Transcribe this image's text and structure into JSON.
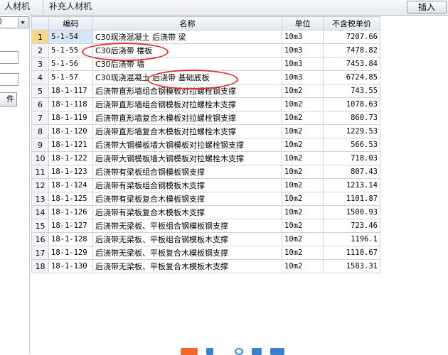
{
  "tabs": [
    "人材机",
    "补充人材机"
  ],
  "insert_button": "插入",
  "left_panel": {
    "combo_value": ")",
    "button_label": "件"
  },
  "columns": {
    "index": "",
    "code": "编码",
    "name": "名称",
    "unit": "单位",
    "price": "不含税单价"
  },
  "rows": [
    {
      "index": "1",
      "code": "5-1-54",
      "name": "C30现浇混凝土 后浇带 梁",
      "unit": "10m3",
      "price": "7207.66"
    },
    {
      "index": "2",
      "code": "5-1-55",
      "name": "C30后浇带 楼板",
      "unit": "10m3",
      "price": "7478.82"
    },
    {
      "index": "3",
      "code": "5-1-56",
      "name": "C30后浇带 墙",
      "unit": "10m3",
      "price": "7453.84"
    },
    {
      "index": "4",
      "code": "5-1-57",
      "name": "C30现浇混凝土 后浇带 基础底板",
      "unit": "10m3",
      "price": "6724.85"
    },
    {
      "index": "5",
      "code": "18-1-117",
      "name": "后浇带直形墙组合钢模板对拉螺栓钢支撑",
      "unit": "10m2",
      "price": "743.55"
    },
    {
      "index": "6",
      "code": "18-1-118",
      "name": "后浇带直形墙组合钢模板对拉螺栓木支撑",
      "unit": "10m2",
      "price": "1078.63"
    },
    {
      "index": "7",
      "code": "18-1-119",
      "name": "后浇带直形墙复合木模板对拉螺栓钢支撑",
      "unit": "10m2",
      "price": "860.73"
    },
    {
      "index": "8",
      "code": "18-1-120",
      "name": "后浇带直形墙复合木模板对拉螺栓木支撑",
      "unit": "10m2",
      "price": "1229.53"
    },
    {
      "index": "9",
      "code": "18-1-121",
      "name": "后浇带大钢模板墙大钢模板对拉螺栓钢支撑",
      "unit": "10m2",
      "price": "566.53"
    },
    {
      "index": "10",
      "code": "18-1-122",
      "name": "后浇带大钢模板墙大钢模板对拉螺栓木支撑",
      "unit": "10m2",
      "price": "718.03"
    },
    {
      "index": "11",
      "code": "18-1-123",
      "name": "后浇带有梁板组合钢模板钢支撑",
      "unit": "10m2",
      "price": "807.43"
    },
    {
      "index": "12",
      "code": "18-1-124",
      "name": "后浇带有梁板组合钢模板木支撑",
      "unit": "10m2",
      "price": "1213.14"
    },
    {
      "index": "13",
      "code": "18-1-125",
      "name": "后浇带有梁板复合木模板钢支撑",
      "unit": "10m2",
      "price": "1101.87"
    },
    {
      "index": "14",
      "code": "18-1-126",
      "name": "后浇带有梁板复合木模板木支撑",
      "unit": "10m2",
      "price": "1500.93"
    },
    {
      "index": "15",
      "code": "18-1-127",
      "name": "后浇带无梁板、平板组合钢模板钢支撑",
      "unit": "10m2",
      "price": "723.46"
    },
    {
      "index": "16",
      "code": "18-1-128",
      "name": "后浇带无梁板、平板组合钢模板木支撑",
      "unit": "10m2",
      "price": "1196.1"
    },
    {
      "index": "17",
      "code": "18-1-129",
      "name": "后浇带无梁板、平板复合木模板钢支撑",
      "unit": "10m2",
      "price": "1110.67"
    },
    {
      "index": "18",
      "code": "18-1-130",
      "name": "后浇带无梁板、平板复合木模板木支撑",
      "unit": "10m2",
      "price": "1583.31"
    }
  ],
  "colors": {
    "annotation": "#e03232",
    "selected_index": "#f7d88a",
    "selected_code": "#d6e6f7"
  }
}
